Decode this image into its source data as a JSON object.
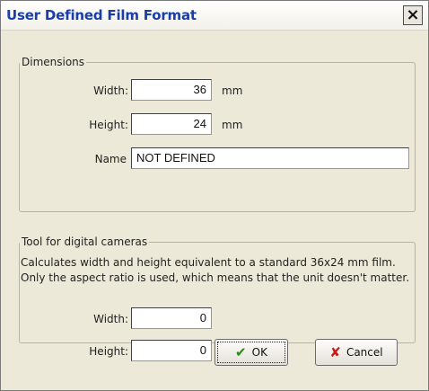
{
  "window": {
    "title": "User Defined Film Format",
    "close_symbol": "×"
  },
  "dimensions": {
    "legend": "Dimensions",
    "width_label": "Width:",
    "width_value": "36",
    "width_unit": "mm",
    "height_label": "Height:",
    "height_value": "24",
    "height_unit": "mm",
    "name_label": "Name",
    "name_value": "NOT DEFINED"
  },
  "tool": {
    "legend": "Tool for digital cameras",
    "description": "Calculates width and height equivalent to a standard 36x24 mm film. Only the aspect ratio is used, which means that the unit doesn't matter.",
    "width_label": "Width:",
    "width_value": "0",
    "height_label": "Height:",
    "height_value": "0"
  },
  "buttons": {
    "ok": {
      "label": "OK",
      "icon": "check-icon",
      "glyph": "✔"
    },
    "cancel": {
      "label": "Cancel",
      "icon": "cross-icon",
      "glyph": "✘"
    }
  }
}
